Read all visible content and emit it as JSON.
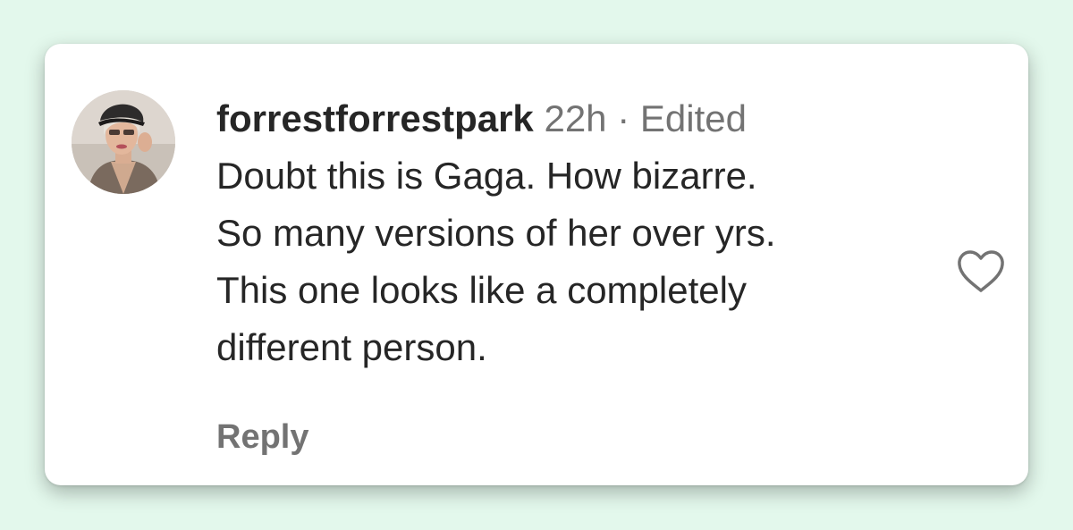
{
  "comment": {
    "username": "forrestforrestpark",
    "time": "22h",
    "separator": "·",
    "edited": "Edited",
    "text_lines": [
      "Doubt this is Gaga. How bizarre.",
      "So many versions of her over yrs.",
      "This one looks like a completely",
      "different person."
    ],
    "reply_label": "Reply",
    "like_icon": "heart-outline-icon",
    "avatar_icon": "profile-photo"
  },
  "colors": {
    "page_background": "#e3f8ec",
    "card_background": "#ffffff",
    "primary_text": "#262626",
    "secondary_text": "#737373"
  }
}
